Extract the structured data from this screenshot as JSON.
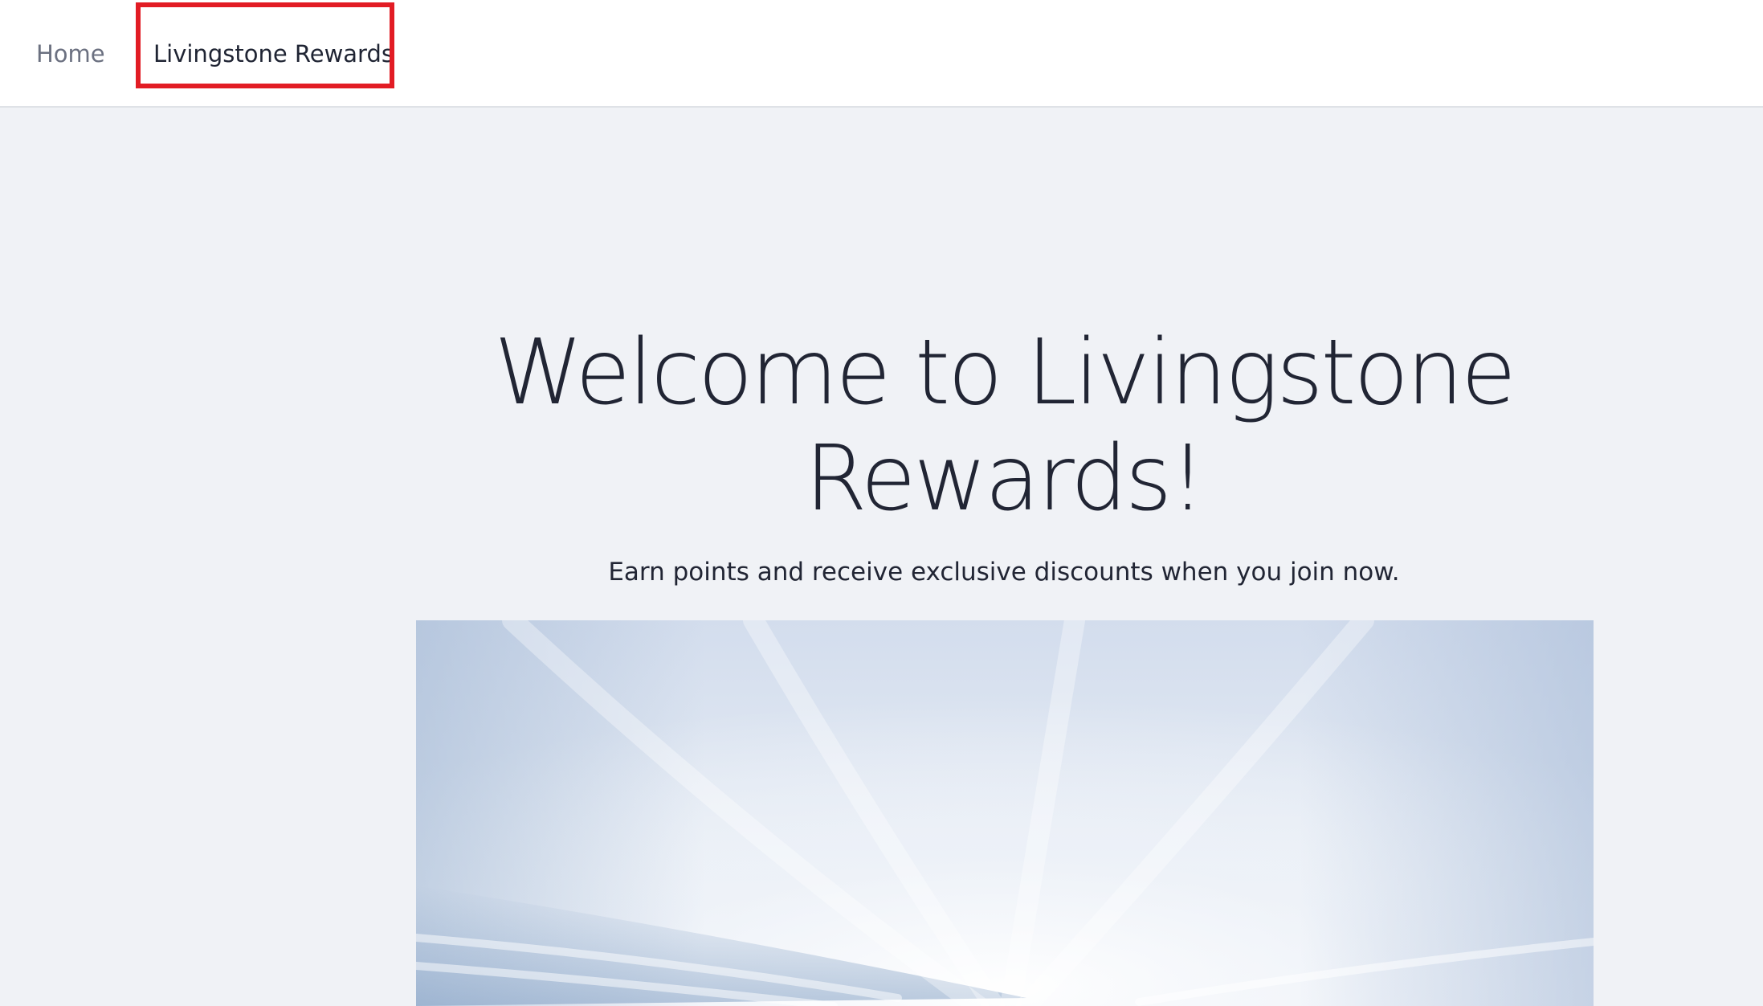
{
  "nav": {
    "items": [
      {
        "label": "Home"
      },
      {
        "label": "Livingstone Rewards"
      }
    ]
  },
  "hero": {
    "title": "Welcome to Livingstone Rewards!",
    "subtitle": "Earn points and receive exclusive discounts when you join now.",
    "image": "sky-clouds-image"
  },
  "colors": {
    "background": "#f0f2f6",
    "navbar": "#ffffff",
    "highlight": "#e21c24",
    "text": "#212534",
    "muted_link": "#6b7080"
  }
}
